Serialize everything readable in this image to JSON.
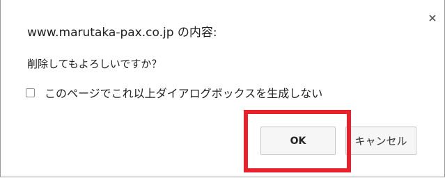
{
  "dialog": {
    "title": "www.marutaka-pax.co.jp の内容:",
    "message": "削除してもよろしいですか？",
    "checkbox_label": "このページでこれ以上ダイアログボックスを生成しない",
    "checkbox_checked": false,
    "ok_label": "OK",
    "cancel_label": "キャンセル",
    "close_icon": "close-icon"
  },
  "colors": {
    "highlight": "#e8212c",
    "button_bg": "#f6f6f6",
    "button_border": "#c6c6c6",
    "text": "#202020"
  }
}
